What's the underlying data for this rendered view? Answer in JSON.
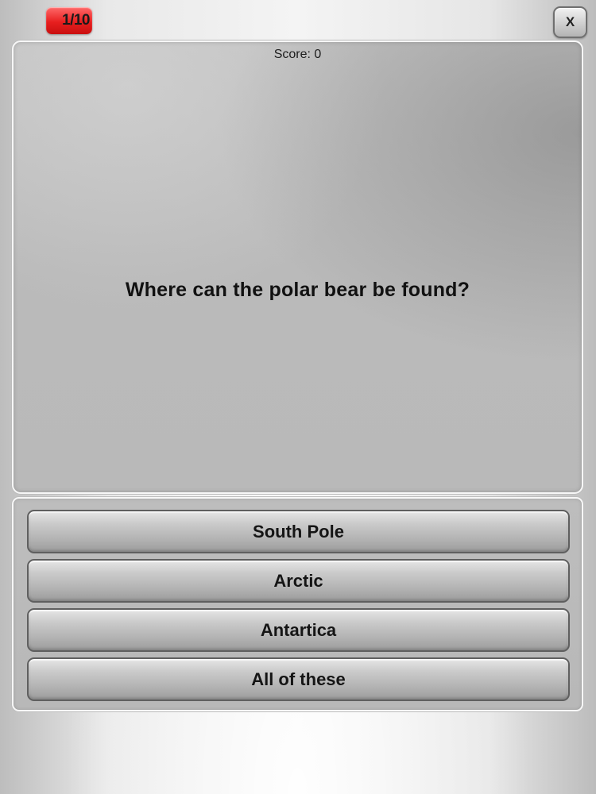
{
  "header": {
    "progress": "1/10",
    "close_label": "X"
  },
  "question_panel": {
    "score": "Score: 0",
    "question": "Where can the polar bear be found?"
  },
  "answers": [
    {
      "label": "South Pole"
    },
    {
      "label": "Arctic"
    },
    {
      "label": "Antartica"
    },
    {
      "label": "All of these"
    }
  ],
  "colors": {
    "progress_badge": "#e81f1f",
    "panel": "#bdbdbd",
    "button": "#b2b2b2"
  }
}
